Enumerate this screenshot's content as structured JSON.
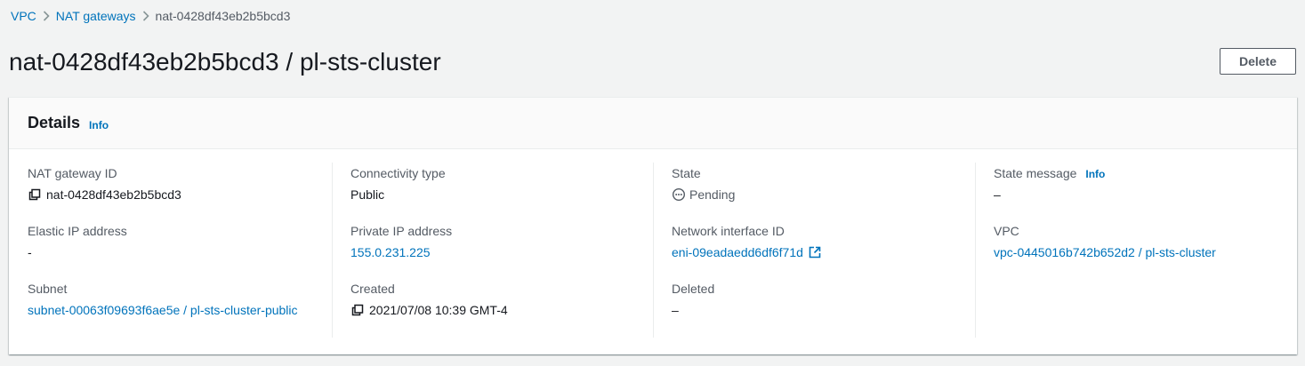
{
  "breadcrumb": {
    "items": [
      {
        "label": "VPC"
      },
      {
        "label": "NAT gateways"
      }
    ],
    "current": "nat-0428df43eb2b5bcd3",
    "separator_icon": "chevron-right-icon"
  },
  "page": {
    "title": "nat-0428df43eb2b5bcd3 / pl-sts-cluster",
    "delete_label": "Delete"
  },
  "details": {
    "title": "Details",
    "info_label": "Info",
    "fields": {
      "nat_gateway_id": {
        "label": "NAT gateway ID",
        "value": "nat-0428df43eb2b5bcd3",
        "icon": "copy-icon"
      },
      "elastic_ip": {
        "label": "Elastic IP address",
        "value": "-"
      },
      "subnet": {
        "label": "Subnet",
        "value": "subnet-00063f09693f6ae5e / pl-sts-cluster-public"
      },
      "connectivity_type": {
        "label": "Connectivity type",
        "value": "Public"
      },
      "private_ip": {
        "label": "Private IP address",
        "value": "155.0.231.225"
      },
      "created": {
        "label": "Created",
        "value": "2021/07/08 10:39 GMT-4",
        "icon": "copy-icon"
      },
      "state": {
        "label": "State",
        "value": "Pending",
        "icon": "pending-icon"
      },
      "network_interface": {
        "label": "Network interface ID",
        "value": "eni-09eadaedd6df6f71d",
        "icon": "external-link-icon"
      },
      "deleted": {
        "label": "Deleted",
        "value": "–"
      },
      "state_message": {
        "label": "State message",
        "info_label": "Info",
        "value": "–"
      },
      "vpc": {
        "label": "VPC",
        "value": "vpc-0445016b742b652d2 / pl-sts-cluster"
      }
    }
  },
  "colors": {
    "link": "#0073bb",
    "background": "#f2f3f3",
    "text": "#16191f",
    "label": "#545b64"
  }
}
